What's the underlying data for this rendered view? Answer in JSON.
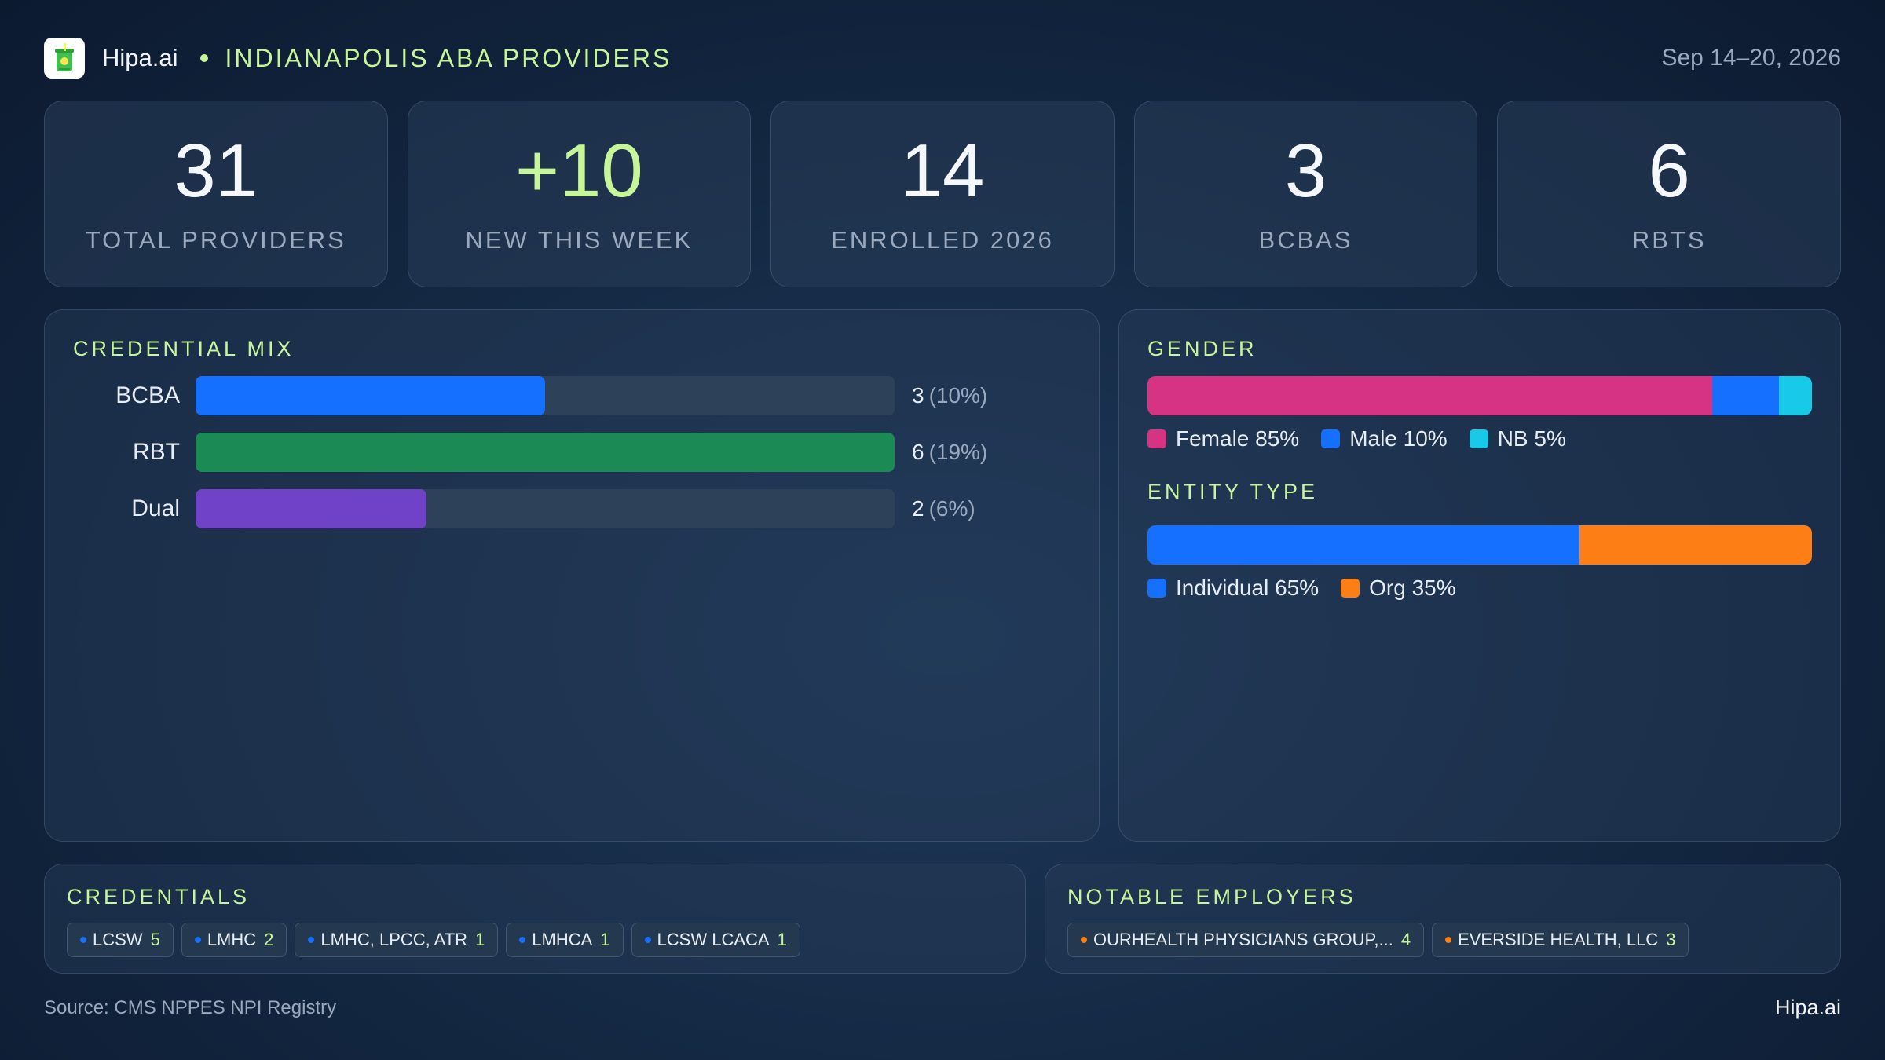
{
  "header": {
    "brand": "Hipa.ai",
    "logo_icon": "cup-icon",
    "title": "INDIANAPOLIS ABA PROVIDERS",
    "date_range": "Sep 14–20, 2026"
  },
  "kpis": [
    {
      "value": "31",
      "label": "TOTAL PROVIDERS"
    },
    {
      "value": "+10",
      "label": "NEW THIS WEEK"
    },
    {
      "value": "14",
      "label": "ENROLLED 2026"
    },
    {
      "value": "3",
      "label": "BCBAS"
    },
    {
      "value": "6",
      "label": "RBTS"
    }
  ],
  "credential_mix": {
    "title": "CREDENTIAL MIX",
    "rows": [
      {
        "label": "BCBA",
        "count": "3",
        "pct": "(10%)",
        "fill": 0.5,
        "color": "#1670ff"
      },
      {
        "label": "RBT",
        "count": "6",
        "pct": "(19%)",
        "fill": 1.0,
        "color": "#1b8a55"
      },
      {
        "label": "Dual",
        "count": "2",
        "pct": "(6%)",
        "fill": 0.33,
        "color": "#6f42c8"
      }
    ]
  },
  "gender": {
    "title": "GENDER",
    "segments": [
      {
        "label": "Female 85%",
        "value": 85,
        "color": "#d63384"
      },
      {
        "label": "Male 10%",
        "value": 10,
        "color": "#1670ff"
      },
      {
        "label": "NB 5%",
        "value": 5,
        "color": "#18c9e8"
      }
    ]
  },
  "entity_type": {
    "title": "ENTITY TYPE",
    "segments": [
      {
        "label": "Individual 65%",
        "value": 65,
        "color": "#1670ff"
      },
      {
        "label": "Org 35%",
        "value": 35,
        "color": "#fd7e14"
      }
    ]
  },
  "credentials": {
    "title": "CREDENTIALS",
    "dot_color": "#1670ff",
    "chips": [
      {
        "label": "LCSW",
        "count": "5"
      },
      {
        "label": "LMHC",
        "count": "2"
      },
      {
        "label": "LMHC, LPCC, ATR",
        "count": "1"
      },
      {
        "label": "LMHCA",
        "count": "1"
      },
      {
        "label": "LCSW LCACA",
        "count": "1"
      }
    ]
  },
  "employers": {
    "title": "NOTABLE EMPLOYERS",
    "dot_color": "#fd7e14",
    "chips": [
      {
        "label": "OURHEALTH PHYSICIANS GROUP,...",
        "count": "4"
      },
      {
        "label": "EVERSIDE HEALTH, LLC",
        "count": "3"
      }
    ]
  },
  "footer": {
    "source": "Source: CMS NPPES NPI Registry",
    "brand": "Hipa.ai"
  }
}
